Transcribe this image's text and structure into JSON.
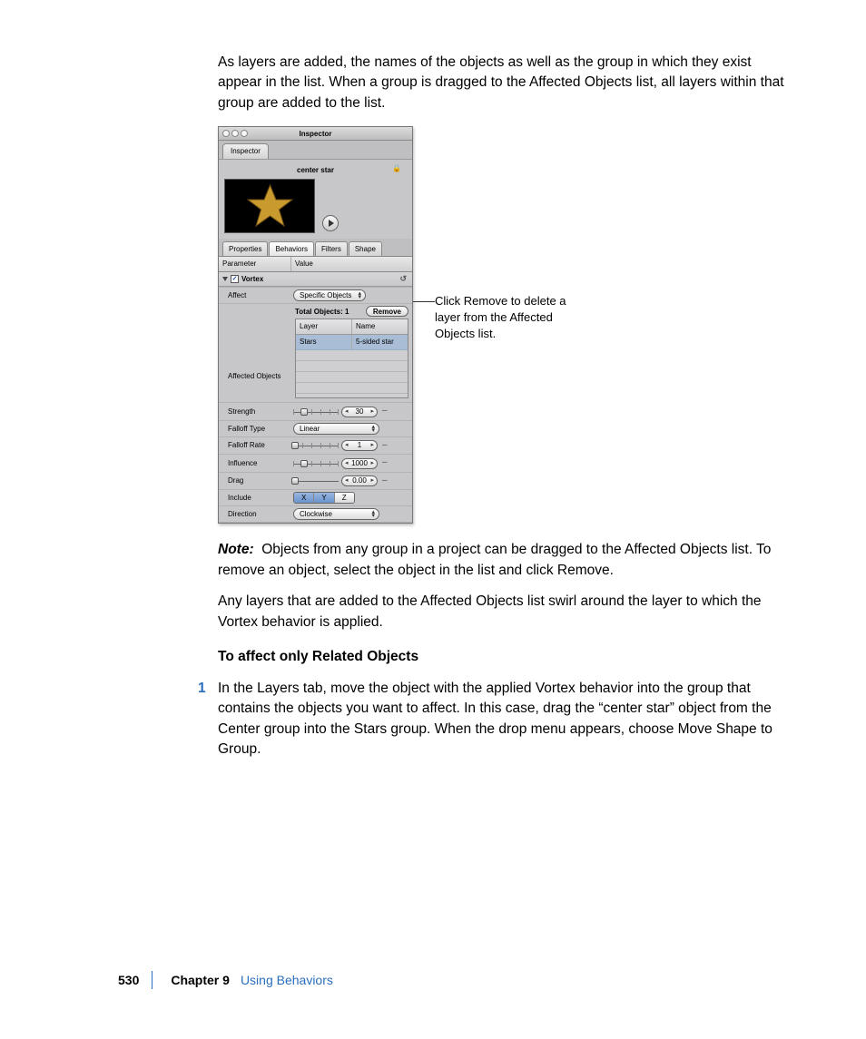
{
  "intro_para": "As layers are added, the names of the objects as well as the group in which they exist appear in the list. When a group is dragged to the Affected Objects list, all layers within that group are added to the list.",
  "callout_text": "Click Remove to delete a layer from the Affected Objects list.",
  "note_label": "Note:",
  "note_text": "Objects from any group in a project can be dragged to the Affected Objects list. To remove an object, select the object in the list and click Remove.",
  "para2": "Any layers that are added to the Affected Objects list swirl around the layer to which the Vortex behavior is applied.",
  "step_head": "To affect only Related Objects",
  "step_num": "1",
  "step_text": "In the Layers tab, move the object with the applied Vortex behavior into the group that contains the objects you want to affect. In this case, drag the “center star” object from the Center group into the Stars group. When the drop menu appears, choose Move Shape to Group.",
  "footer": {
    "page": "530",
    "chapter": "Chapter 9",
    "title": "Using Behaviors"
  },
  "inspector": {
    "window_title": "Inspector",
    "outer_tab": "Inspector",
    "object_name": "center star",
    "tabs": [
      "Properties",
      "Behaviors",
      "Filters",
      "Shape"
    ],
    "active_tab": 1,
    "param_header": "Parameter",
    "value_header": "Value",
    "group_name": "Vortex",
    "params": {
      "affect": {
        "label": "Affect",
        "value": "Specific Objects"
      },
      "affected_objects": {
        "label": "Affected Objects",
        "total_label": "Total Objects: 1",
        "remove_btn": "Remove",
        "columns": [
          "Layer",
          "Name"
        ],
        "rows": [
          [
            "Stars",
            "5-sided star"
          ]
        ]
      },
      "strength": {
        "label": "Strength",
        "value": "30"
      },
      "falloff_type": {
        "label": "Falloff Type",
        "value": "Linear"
      },
      "falloff_rate": {
        "label": "Falloff Rate",
        "value": "1"
      },
      "influence": {
        "label": "Influence",
        "value": "1000"
      },
      "drag": {
        "label": "Drag",
        "value": "0.00"
      },
      "include": {
        "label": "Include",
        "axes": [
          "X",
          "Y",
          "Z"
        ]
      },
      "direction": {
        "label": "Direction",
        "value": "Clockwise"
      }
    }
  }
}
